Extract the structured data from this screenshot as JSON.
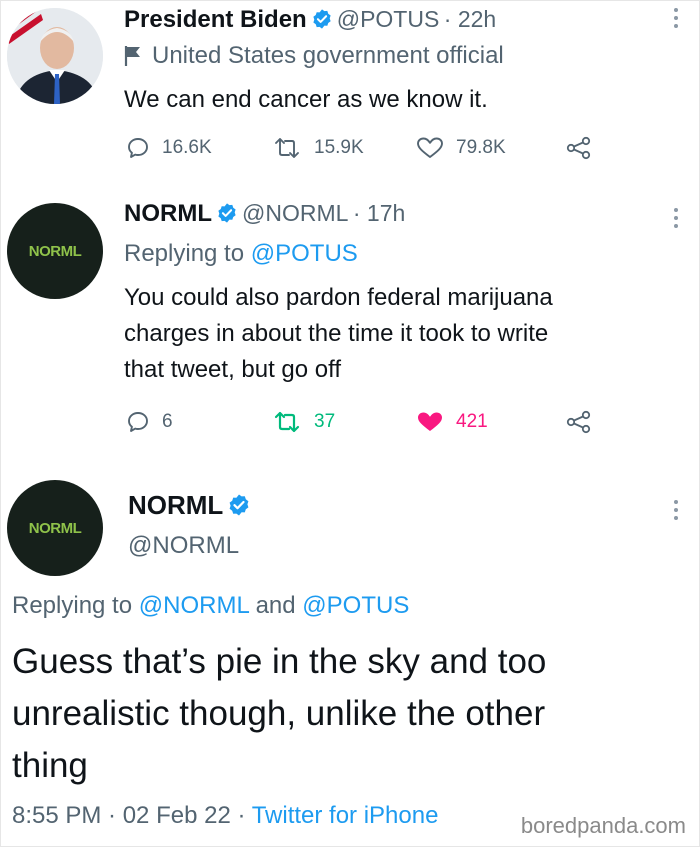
{
  "tweet1": {
    "name": "President Biden",
    "handle": "@POTUS",
    "time": "· 22h",
    "label": "United States government official",
    "text": "We can end cancer as we know it.",
    "replies": "16.6K",
    "retweets": "15.9K",
    "likes": "79.8K"
  },
  "tweet2": {
    "name": "NORML",
    "handle": "@NORML",
    "time": "· 17h",
    "replying_prefix": "Replying to",
    "replying_to": "@POTUS",
    "text_lines": [
      "You could also pardon federal marijuana",
      "charges in about the time it took to write",
      "that tweet, but go off"
    ],
    "replies": "6",
    "retweets": "37",
    "likes": "421",
    "avatar_text": "NORML"
  },
  "tweet3": {
    "name": "NORML",
    "handle": "@NORML",
    "replying_prefix": "Replying to",
    "replying_to_1": "@NORML",
    "replying_and": "and",
    "replying_to_2": "@POTUS",
    "text_lines": [
      "Guess that’s pie in the sky and too",
      "unrealistic though, unlike the other",
      "thing"
    ],
    "timestamp": "8:55 PM · 02 Feb 22 ·",
    "source": "Twitter for iPhone",
    "avatar_text": "NORML"
  },
  "watermark": "boredpanda.com",
  "colors": {
    "link": "#1d9bf0",
    "retweet_active": "#00ba7c",
    "like_active": "#f91880",
    "verified": "#1d9bf0"
  }
}
